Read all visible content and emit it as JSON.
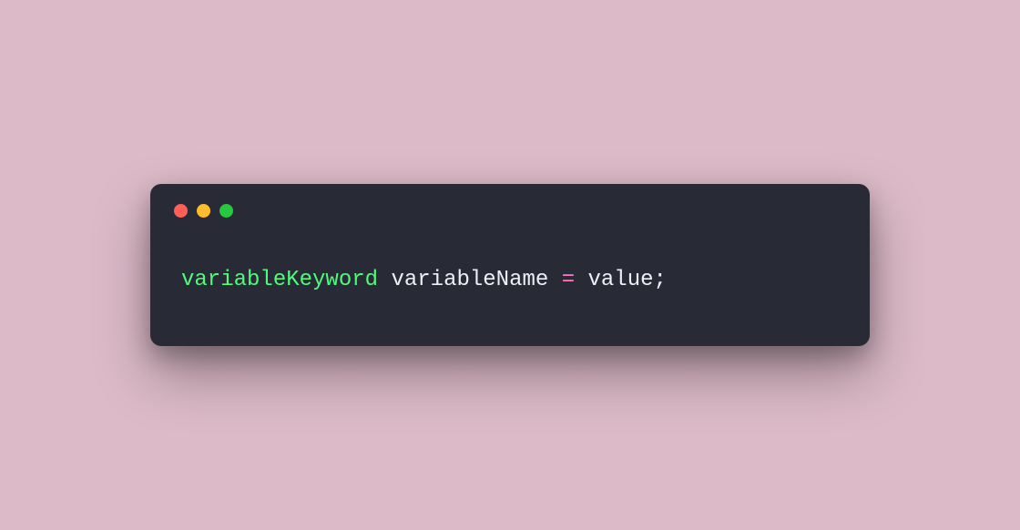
{
  "code": {
    "keyword": "variableKeyword",
    "name": "variableName",
    "operator": "=",
    "value": "value",
    "terminator": ";"
  },
  "window": {
    "traffic_lights": {
      "close": "close",
      "minimize": "minimize",
      "maximize": "maximize"
    }
  }
}
